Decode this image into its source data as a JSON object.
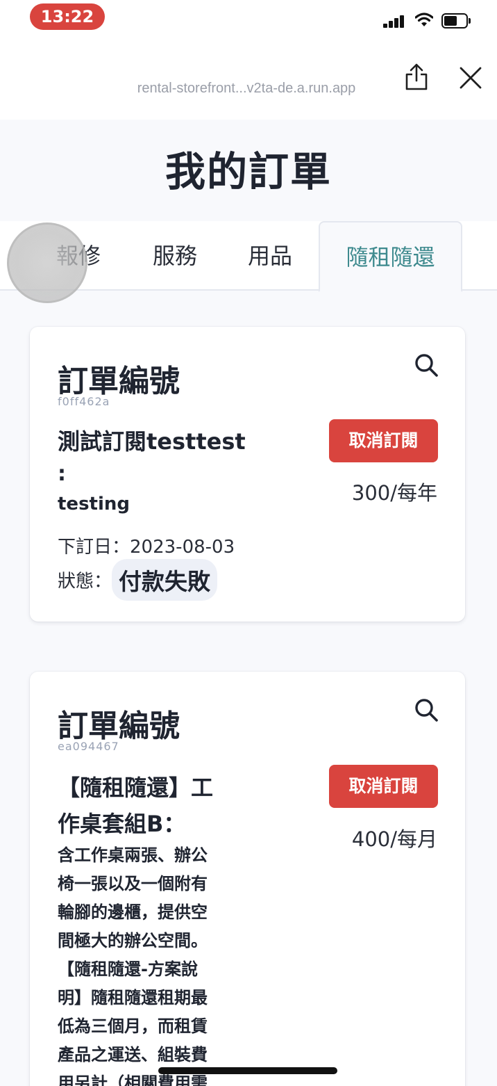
{
  "status_bar": {
    "time": "13:22",
    "icons": [
      "signal-icon",
      "wifi-icon",
      "battery-icon"
    ],
    "time_pill_color": "#d9443e"
  },
  "browser": {
    "url": "rental-storefront...v2ta-de.a.run.app",
    "share_icon": "share-icon",
    "close_icon": "close-icon"
  },
  "page": {
    "title": "我的訂單"
  },
  "tabs": [
    {
      "label": "報修",
      "active": false
    },
    {
      "label": "服務",
      "active": false
    },
    {
      "label": "用品",
      "active": false
    },
    {
      "label": "隨租隨還",
      "active": true
    }
  ],
  "orders": [
    {
      "heading": "訂單編號",
      "order_id": "f0ff462a",
      "product_title": "測試訂閱testtest",
      "product_colon": ":",
      "product_subtitle": "testing",
      "cancel_label": "取消訂閱",
      "price": "300/每年",
      "order_date_label": "下訂日：",
      "order_date": "2023-08-03",
      "status_label": "狀態：",
      "status": "付款失敗"
    },
    {
      "heading": "訂單編號",
      "order_id": "ea094467",
      "product_title_lines": [
        "【隨租隨還】工",
        "作桌套組B："
      ],
      "description_lines": [
        "含工作桌兩張、辦公",
        "椅一張以及一個附有",
        "輪腳的邊櫃，提供空",
        "間極大的辦公空間。",
        "【隨租隨還-方案說",
        "明】隨租隨還租期最",
        "低為三個月，而租賃",
        "產品之運送、組裝費",
        "用另計（相關費用需"
      ],
      "cancel_label": "取消訂閱",
      "price": "400/每月"
    }
  ],
  "colors": {
    "accent_teal": "#3e8a8e",
    "cancel_red": "#d9443e",
    "background": "#f8f9fc"
  }
}
